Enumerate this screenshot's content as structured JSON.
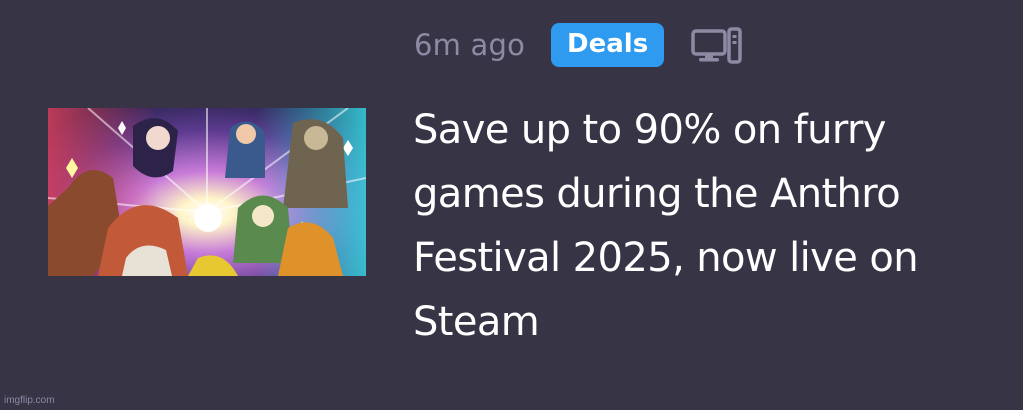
{
  "article": {
    "timestamp": "6m ago",
    "tag": "Deals",
    "platform_icon": "pc-monitor-icon",
    "headline": "Save up to 90% on furry games during the Anthro Festival 2025, now live on Steam",
    "thumbnail_icon": "festival-artwork-thumbnail"
  },
  "watermark": "imgflip.com",
  "colors": {
    "background": "#363445",
    "tag_background": "#2e9bf0",
    "muted_text": "#8d8aa3",
    "headline_text": "#ffffff"
  }
}
